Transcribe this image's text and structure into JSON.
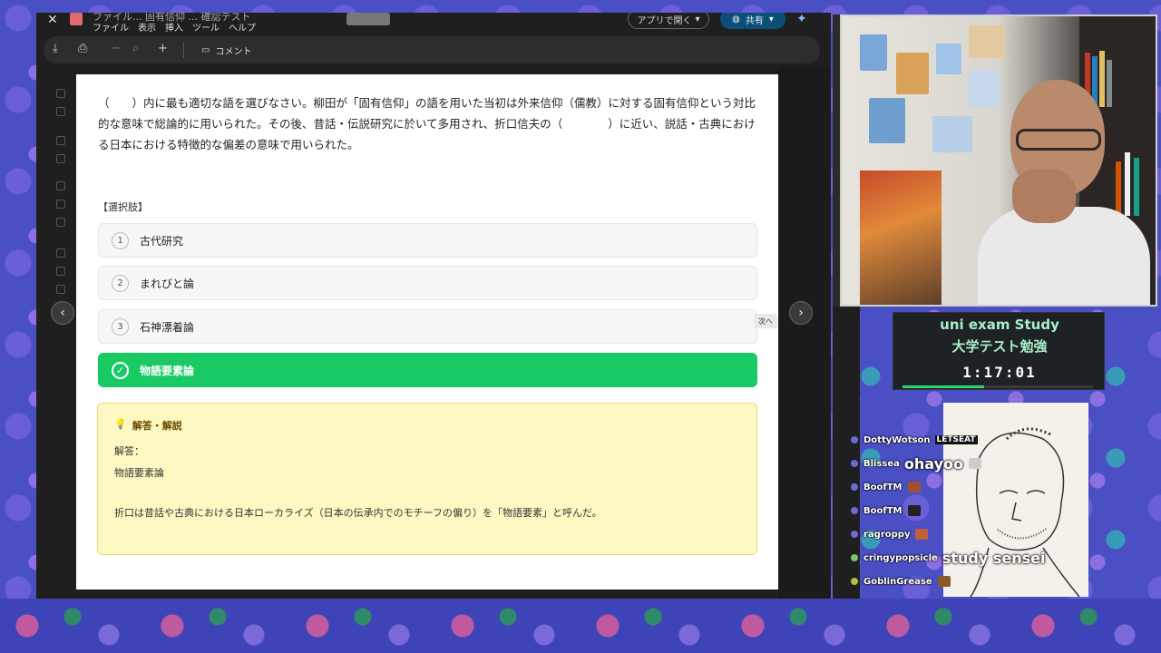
{
  "docs": {
    "title": "ファイル... 固有信仰 ... 確認テスト",
    "menu": [
      "ファイル",
      "表示",
      "挿入",
      "ツール",
      "ヘルプ"
    ],
    "open_app_label": "アプリで開く",
    "share_label": "共有",
    "comment_label": "コメント"
  },
  "question": {
    "text": "（　　）内に最も適切な語を選びなさい。柳田が「固有信仰」の語を用いた当初は外来信仰（儒教）に対する固有信仰という対比的な意味で総論的に用いられた。その後、昔話・伝説研究に於いて多用され、折口信夫の（　　　　）に近い、説話・古典における日本における特徴的な偏差の意味で用いられた。",
    "choices_label": "【選択肢】",
    "choices": [
      {
        "num": "1",
        "text": "古代研究",
        "selected": false
      },
      {
        "num": "2",
        "text": "まれびと論",
        "selected": false
      },
      {
        "num": "3",
        "text": "石神漂着論",
        "selected": false
      },
      {
        "num": "✓",
        "text": "物語要素論",
        "selected": true
      }
    ]
  },
  "answer": {
    "heading": "解答・解説",
    "label": "解答：",
    "value": "物語要素論",
    "explanation": "折口は昔話や古典における日本ローカライズ（日本の伝承内でのモチーフの偏り）を「物語要素」と呼んだ。"
  },
  "navigation": {
    "next_tooltip": "次へ"
  },
  "timer": {
    "line1": "uni exam Study",
    "line2": "大学テスト勉強",
    "clock": "1:17:01",
    "progress": 0.43
  },
  "chat": [
    {
      "user": "DottyWotson",
      "message": "",
      "emote_text": "LETSEAT",
      "badge_color": "#6b6bd6"
    },
    {
      "user": "Blissea",
      "message": "ohayoo",
      "emote_text": "",
      "badge_color": "#6b6bd6"
    },
    {
      "user": "BoofTM",
      "message": "",
      "emote_text": "",
      "badge_color": "#6b6bd6"
    },
    {
      "user": "BoofTM",
      "message": "",
      "emote_text": "",
      "badge_color": "#6b6bd6"
    },
    {
      "user": "ragroppy",
      "message": "",
      "emote_text": "",
      "badge_color": "#6b6bd6"
    },
    {
      "user": "cringypopsicle",
      "message": "study sensei",
      "emote_text": "",
      "badge_color": "#7cc46a"
    },
    {
      "user": "GoblinGrease",
      "message": "",
      "emote_text": "",
      "badge_color": "#b0c040"
    }
  ],
  "colors": {
    "selected_choice": "#18c964",
    "answer_box": "#fef9c3",
    "share_button": "#0b4f79",
    "timer_text": "#a8f0c8"
  }
}
